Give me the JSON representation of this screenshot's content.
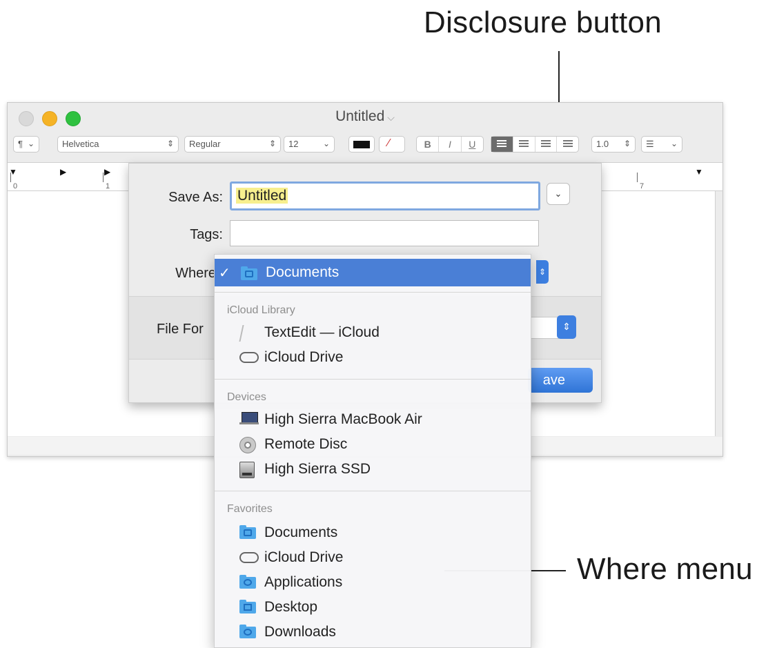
{
  "callouts": {
    "disclosure": "Disclosure button",
    "where_menu": "Where menu"
  },
  "window": {
    "title": "Untitled",
    "toolbar": {
      "paragraph": "¶",
      "font": "Helvetica",
      "style": "Regular",
      "size": "12",
      "bold": "B",
      "italic": "I",
      "underline": "U",
      "line_spacing": "1.0"
    },
    "ruler": [
      "0",
      "1",
      "7"
    ]
  },
  "save_sheet": {
    "save_as_label": "Save As:",
    "save_as_value": "Untitled",
    "tags_label": "Tags:",
    "tags_value": "",
    "where_label": "Where",
    "file_format_label": "File For",
    "save_button": "Save",
    "save_button_visible": "ave"
  },
  "where_menu": {
    "selected": "Documents",
    "sections": [
      {
        "header": "iCloud Library",
        "items": [
          {
            "label": "TextEdit — iCloud",
            "icon": "textedit-icon"
          },
          {
            "label": "iCloud Drive",
            "icon": "cloud-icon"
          }
        ]
      },
      {
        "header": "Devices",
        "items": [
          {
            "label": "High Sierra MacBook Air",
            "icon": "laptop-icon"
          },
          {
            "label": "Remote Disc",
            "icon": "disc-icon"
          },
          {
            "label": "High Sierra SSD",
            "icon": "drive-icon"
          }
        ]
      },
      {
        "header": "Favorites",
        "items": [
          {
            "label": "Documents",
            "icon": "documents-folder-icon"
          },
          {
            "label": "iCloud Drive",
            "icon": "cloud-icon"
          },
          {
            "label": "Applications",
            "icon": "applications-folder-icon"
          },
          {
            "label": "Desktop",
            "icon": "desktop-folder-icon"
          },
          {
            "label": "Downloads",
            "icon": "downloads-folder-icon"
          }
        ]
      }
    ]
  },
  "colors": {
    "accent": "#4a7fd6",
    "selection_highlight": "#f7ef8e",
    "focus_ring": "#7fa8e0"
  }
}
